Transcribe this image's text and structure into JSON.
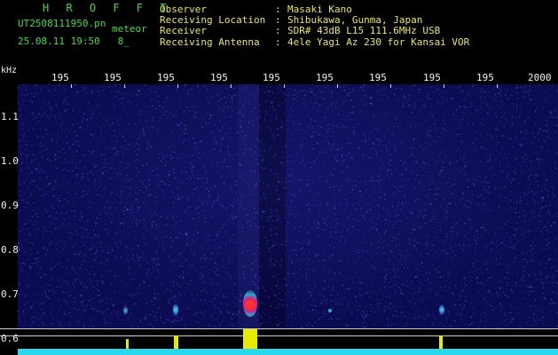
{
  "header": {
    "title": "H R O F F T",
    "filename": "UT2508111950.pn",
    "meteor_label": "meteor",
    "datetime": "25.08.11 19:50   8_",
    "fields": [
      {
        "label": "Observer",
        "sep": ":",
        "value": "Masaki Kano"
      },
      {
        "label": "Receiving Location",
        "sep": ":",
        "value": "Shibukawa, Gunma, Japan"
      },
      {
        "label": "Receiver",
        "sep": ":",
        "value": "SDR# 43dB L15 111.6MHz USB"
      },
      {
        "label": "Receiving Antenna",
        "sep": ":",
        "value": "4ele Yagi Az 230 for Kansai VOR"
      }
    ]
  },
  "axes": {
    "y_unit": "kHz",
    "x_ticks": [
      "195",
      "195",
      "195",
      "195",
      "195",
      "195",
      "195",
      "195",
      "195",
      "2000"
    ],
    "y_ticks": [
      "1.1",
      "1.0",
      "0.9",
      "0.8",
      "0.7",
      "0.6"
    ]
  },
  "colors": {
    "background": "#000000",
    "spectrum": "#0b0b52",
    "title": "#3fdc3f",
    "header_text": "#e8e85a",
    "meteor_echo": "#e8e800",
    "floor": "#28d9ee"
  }
}
